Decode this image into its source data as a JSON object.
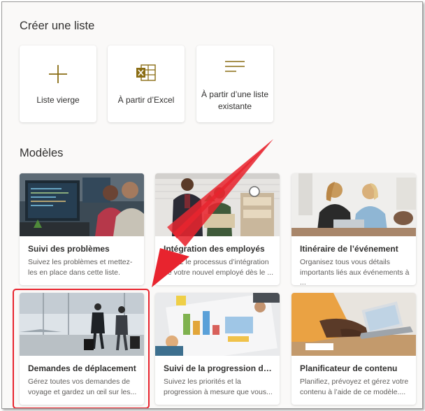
{
  "create": {
    "heading": "Créer une liste",
    "cards": [
      {
        "label": "Liste vierge",
        "icon": "plus-icon"
      },
      {
        "label": "À partir d’Excel",
        "icon": "excel-icon"
      },
      {
        "label": "À partir d’une liste existante",
        "icon": "list-lines-icon"
      }
    ]
  },
  "templates": {
    "heading": "Modèles",
    "items": [
      {
        "title": "Suivi des problèmes",
        "desc": "Suivez les problèmes et mettez-les en place dans cette liste."
      },
      {
        "title": "Intégration des employés",
        "desc": "Gérez le processus d’intégration de votre nouvel employé dès le ..."
      },
      {
        "title": "Itinéraire de l’événement",
        "desc": "Organisez tous vous détails importants liés aux événements à ..."
      },
      {
        "title": "Demandes de déplacement",
        "desc": "Gérez toutes vos demandes de voyage et gardez un œil sur les..."
      },
      {
        "title": "Suivi de la progression des ...",
        "desc": "Suivez les priorités et la progression à mesure que vous..."
      },
      {
        "title": "Planificateur de contenu",
        "desc": "Planifiez, prévoyez et gérez votre contenu à l’aide de ce modèle...."
      }
    ]
  },
  "colors": {
    "accent_gold": "#8a6d14",
    "annotation_red": "#e8242e",
    "excel_green": "#8a6d14"
  }
}
